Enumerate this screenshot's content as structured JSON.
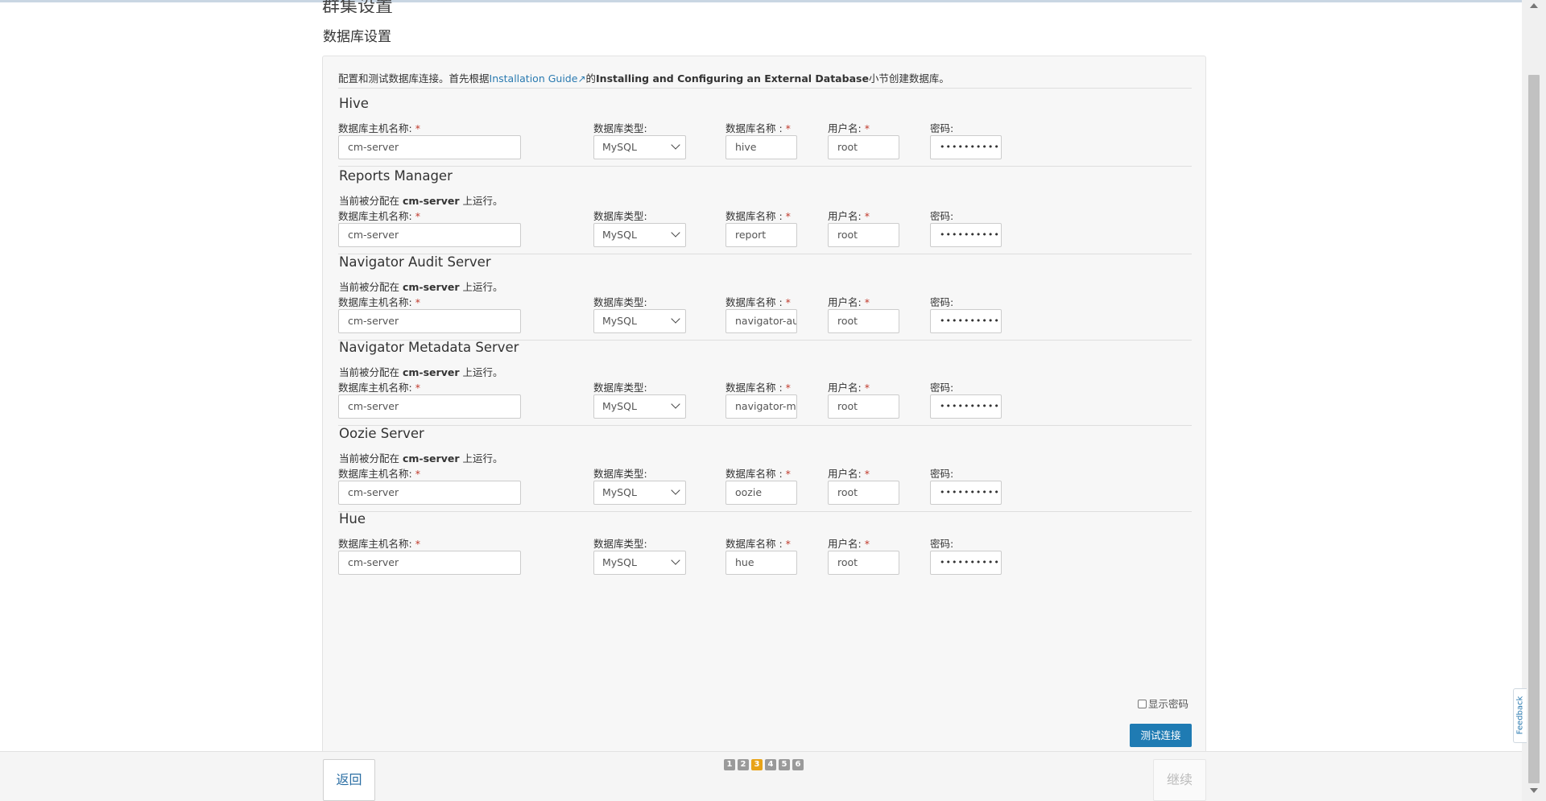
{
  "page_heading": "群集设置",
  "section_heading": "数据库设置",
  "intro": {
    "prefix": "配置和测试数据库连接。首先根据",
    "link": "Installation Guide",
    "ext_icon": "external-link-icon",
    "middle": "的",
    "bold": "Installing and Configuring an External Database",
    "suffix": "小节创建数据库。"
  },
  "labels": {
    "host": "数据库主机名称:",
    "type": "数据库类型:",
    "dbname": "数据库名称 :",
    "user": "用户名:",
    "password": "密码:",
    "required": "*"
  },
  "note": {
    "prefix": "当前被分配在 ",
    "host": "cm-server",
    "suffix": " 上运行。"
  },
  "services": [
    {
      "title": "Hive",
      "host": "cm-server",
      "type": "MySQL",
      "dbname": "hive",
      "user": "root",
      "password": "••••••••••"
    },
    {
      "title": "Reports Manager",
      "host": "cm-server",
      "type": "MySQL",
      "dbname": "report",
      "user": "root",
      "password": "••••••••••"
    },
    {
      "title": "Navigator Audit Server",
      "host": "cm-server",
      "type": "MySQL",
      "dbname": "navigator-audit",
      "user": "root",
      "password": "••••••••••"
    },
    {
      "title": "Navigator Metadata Server",
      "host": "cm-server",
      "type": "MySQL",
      "dbname": "navigator-metadata",
      "user": "root",
      "password": "••••••••••"
    },
    {
      "title": "Oozie Server",
      "host": "cm-server",
      "type": "MySQL",
      "dbname": "oozie",
      "user": "root",
      "password": "••••••••••"
    },
    {
      "title": "Hue",
      "host": "cm-server",
      "type": "MySQL",
      "dbname": "hue",
      "user": "root",
      "password": "••••••••••"
    }
  ],
  "show_password_label": "显示密码",
  "test_button": "测试连接",
  "footer": {
    "back": "返回",
    "continue": "继续",
    "steps": [
      "1",
      "2",
      "3",
      "4",
      "5",
      "6"
    ],
    "active_step": "3"
  },
  "feedback_label": "Feedback",
  "colors": {
    "primary": "#1f7bb3",
    "link": "#2a7ab0",
    "required": "#c0392b",
    "active_step": "#e8a317"
  }
}
